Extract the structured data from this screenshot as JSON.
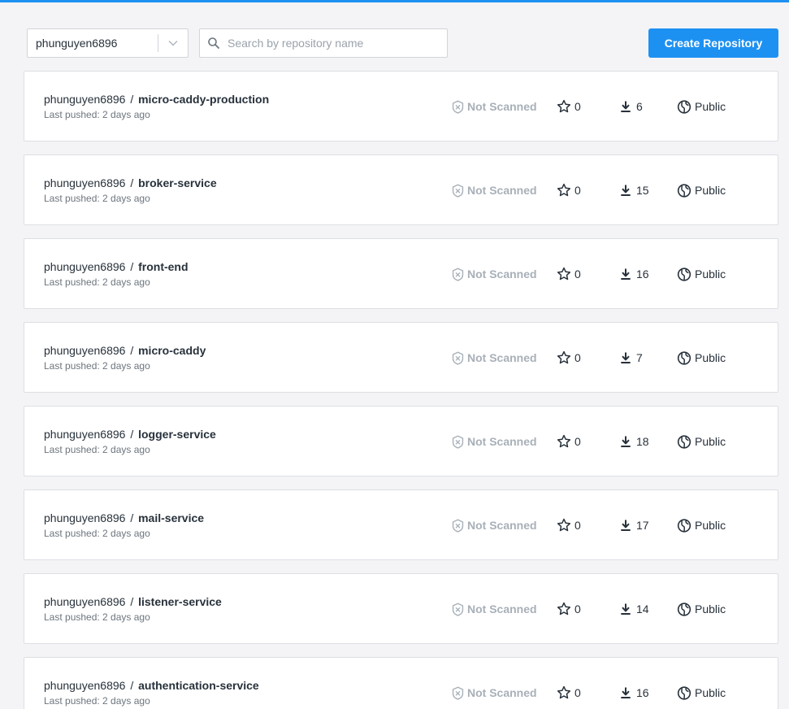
{
  "toolbar": {
    "namespace": "phunguyen6896",
    "search_placeholder": "Search by repository name",
    "create_label": "Create Repository"
  },
  "repositories": [
    {
      "namespace": "phunguyen6896",
      "separator": "/",
      "name": "micro-caddy-production",
      "pushed": "Last pushed: 2 days ago",
      "scan": "Not Scanned",
      "stars": "0",
      "pulls": "6",
      "visibility": "Public"
    },
    {
      "namespace": "phunguyen6896",
      "separator": "/",
      "name": "broker-service",
      "pushed": "Last pushed: 2 days ago",
      "scan": "Not Scanned",
      "stars": "0",
      "pulls": "15",
      "visibility": "Public"
    },
    {
      "namespace": "phunguyen6896",
      "separator": "/",
      "name": "front-end",
      "pushed": "Last pushed: 2 days ago",
      "scan": "Not Scanned",
      "stars": "0",
      "pulls": "16",
      "visibility": "Public"
    },
    {
      "namespace": "phunguyen6896",
      "separator": "/",
      "name": "micro-caddy",
      "pushed": "Last pushed: 2 days ago",
      "scan": "Not Scanned",
      "stars": "0",
      "pulls": "7",
      "visibility": "Public"
    },
    {
      "namespace": "phunguyen6896",
      "separator": "/",
      "name": "logger-service",
      "pushed": "Last pushed: 2 days ago",
      "scan": "Not Scanned",
      "stars": "0",
      "pulls": "18",
      "visibility": "Public"
    },
    {
      "namespace": "phunguyen6896",
      "separator": "/",
      "name": "mail-service",
      "pushed": "Last pushed: 2 days ago",
      "scan": "Not Scanned",
      "stars": "0",
      "pulls": "17",
      "visibility": "Public"
    },
    {
      "namespace": "phunguyen6896",
      "separator": "/",
      "name": "listener-service",
      "pushed": "Last pushed: 2 days ago",
      "scan": "Not Scanned",
      "stars": "0",
      "pulls": "14",
      "visibility": "Public"
    },
    {
      "namespace": "phunguyen6896",
      "separator": "/",
      "name": "authentication-service",
      "pushed": "Last pushed: 2 days ago",
      "scan": "Not Scanned",
      "stars": "0",
      "pulls": "16",
      "visibility": "Public"
    }
  ],
  "icons": {
    "namespace_chevron": "chevron-down-icon",
    "search": "search-icon",
    "scan": "shield-x-icon",
    "stars": "star-icon",
    "pulls": "download-icon",
    "visibility": "globe-icon"
  },
  "colors": {
    "accent": "#1d91f2",
    "not_scanned": "#a8b0b8",
    "text": "#27313b",
    "muted": "#6c757d"
  }
}
